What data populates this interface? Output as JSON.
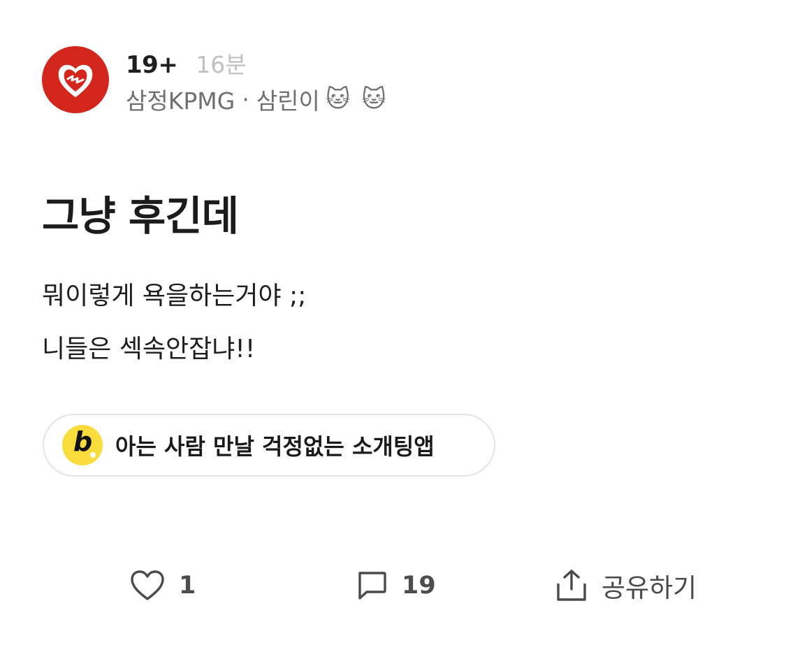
{
  "post": {
    "board": "19+",
    "time": "16분",
    "company": "삼정KPMG",
    "separator": "·",
    "nickname": "삼린이",
    "badges": [
      "🐱",
      "🐱"
    ],
    "title": "그냥 후긴데",
    "body": [
      "뭐이렇게 욕을하는거야 ;;",
      "니들은 섹속안잡냐!!"
    ]
  },
  "ad": {
    "logo_letter": "b",
    "text": "아는 사람 만날 걱정없는 소개팅앱",
    "logo_color": "#f7dc3b"
  },
  "actions": {
    "like_count": "1",
    "comment_count": "19",
    "share_label": "공유하기"
  },
  "colors": {
    "avatar_bg": "#d3271e",
    "muted_text": "#c0c0c0",
    "secondary_text": "#6f6f6f"
  },
  "icons": {
    "avatar": "heart-logo-icon",
    "like": "heart-outline-icon",
    "comment": "speech-bubble-icon",
    "share": "share-upload-icon"
  }
}
